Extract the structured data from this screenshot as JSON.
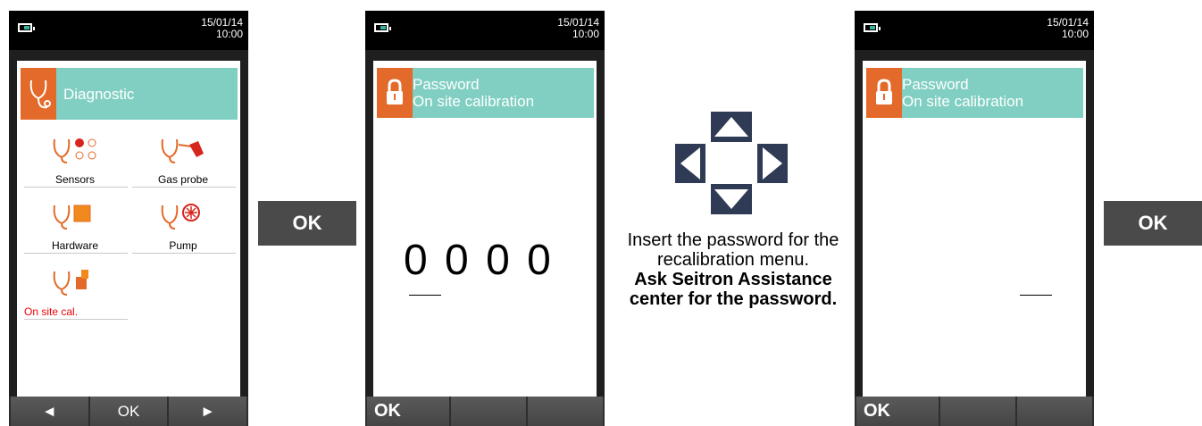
{
  "status": {
    "date": "15/01/14",
    "time": "10:00"
  },
  "screen1": {
    "title": "Diagnostic",
    "items": [
      {
        "label": "Sensors"
      },
      {
        "label": "Gas probe"
      },
      {
        "label": "Hardware"
      },
      {
        "label": "Pump"
      },
      {
        "label": "On site cal."
      }
    ],
    "softkeys": [
      "◄",
      "OK",
      "►"
    ]
  },
  "screen2": {
    "title_line1": "Password",
    "title_line2": "On site calibration",
    "digits": "0000",
    "softkeys": [
      "OK",
      "",
      ""
    ]
  },
  "screen3": {
    "title_line1": "Password",
    "title_line2": "On site calibration",
    "softkeys": [
      "OK",
      "",
      ""
    ]
  },
  "ok_buttons": [
    "OK",
    "OK"
  ],
  "instructions": {
    "line1": "Insert the password for the recalibration menu.",
    "bold": "Ask Seitron Assistance center for the password."
  },
  "colors": {
    "accent_orange": "#e36a2a",
    "header_teal": "#80cfc2",
    "nav_arrow": "#2f3b55"
  }
}
